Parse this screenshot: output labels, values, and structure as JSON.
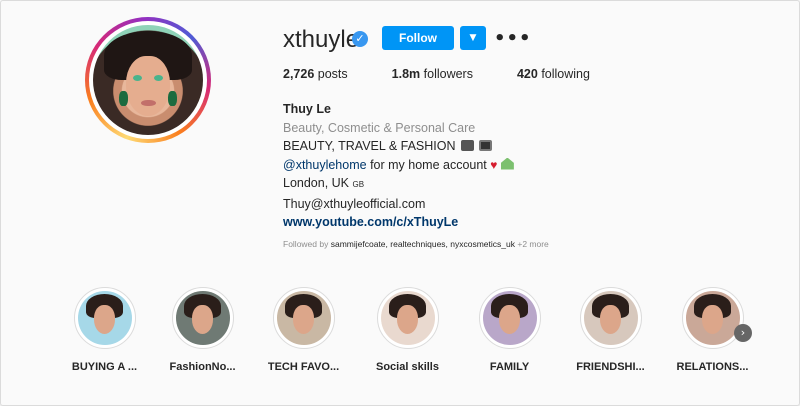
{
  "profile": {
    "username": "xthuyle",
    "follow_label": "Follow",
    "dropdown_icon": "chevron-down",
    "more_icon": "ellipsis",
    "verified": true,
    "posts_count": "2,726",
    "posts_label": "posts",
    "followers_count": "1.8m",
    "followers_label": "followers",
    "following_count": "420",
    "following_label": "following",
    "colors": {
      "accent": "#0095f6",
      "verified": "#3897f0",
      "link": "#00376b"
    }
  },
  "bio": {
    "name": "Thuy Le",
    "category": "Beauty, Cosmetic & Personal Care",
    "line1": "BEAUTY, TRAVEL & FASHION",
    "line2_mention": "@xthuylehome",
    "line2_rest": "for my home account",
    "location": "London, UK",
    "location_flag": "GB",
    "email": "Thuy@xthuyleofficial.com",
    "website": "www.youtube.com/c/xThuyLe",
    "followed_by_prefix": "Followed by",
    "followed_by_names": "sammijefcoate, realtechniques, nyxcosmetics_uk",
    "followed_by_more": "+2 more"
  },
  "highlights": [
    {
      "label": "BUYING A ..."
    },
    {
      "label": "FashionNo..."
    },
    {
      "label": "TECH FAVO..."
    },
    {
      "label": "Social skills"
    },
    {
      "label": "FAMILY"
    },
    {
      "label": "FRIENDSHI..."
    },
    {
      "label": "RELATIONS..."
    }
  ]
}
